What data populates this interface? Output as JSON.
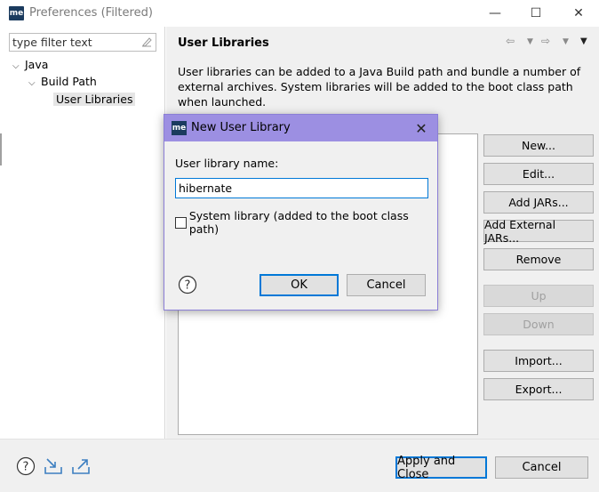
{
  "window": {
    "title": "Preferences (Filtered)",
    "app_icon_text": "me",
    "minimize_glyph": "—",
    "maximize_glyph": "☐",
    "close_glyph": "✕"
  },
  "left_pane": {
    "filter_placeholder": "type filter text",
    "tree": [
      {
        "label": "Java",
        "expanded": true
      },
      {
        "label": "Build Path",
        "expanded": true
      },
      {
        "label": "User Libraries",
        "selected": true
      }
    ]
  },
  "main": {
    "title": "User Libraries",
    "description": "User libraries can be added to a Java Build path and bundle a number of external archives. System libraries will be added to the boot class path when launched.",
    "buttons": {
      "new": "New...",
      "edit": "Edit...",
      "add_jars": "Add JARs...",
      "add_external_jars": "Add External JARs...",
      "remove": "Remove",
      "up": "Up",
      "down": "Down",
      "import": "Import...",
      "export": "Export..."
    }
  },
  "bottom": {
    "apply_close": "Apply and Close",
    "cancel": "Cancel"
  },
  "dialog": {
    "title": "New User Library",
    "icon_text": "me",
    "close_glyph": "✕",
    "name_label": "User library name:",
    "name_value": "hibernate",
    "system_library_label": "System library (added to the boot class path)",
    "system_library_checked": false,
    "ok": "OK",
    "cancel": "Cancel"
  },
  "colors": {
    "dialog_title_bg": "#9c8fe2",
    "focus_border": "#0078d7",
    "app_icon_bg": "#1b3b5e"
  },
  "icons": [
    "help-icon",
    "import-preferences-icon",
    "export-preferences-icon",
    "clear-filter-icon",
    "back-icon",
    "forward-icon",
    "view-menu-icon"
  ]
}
